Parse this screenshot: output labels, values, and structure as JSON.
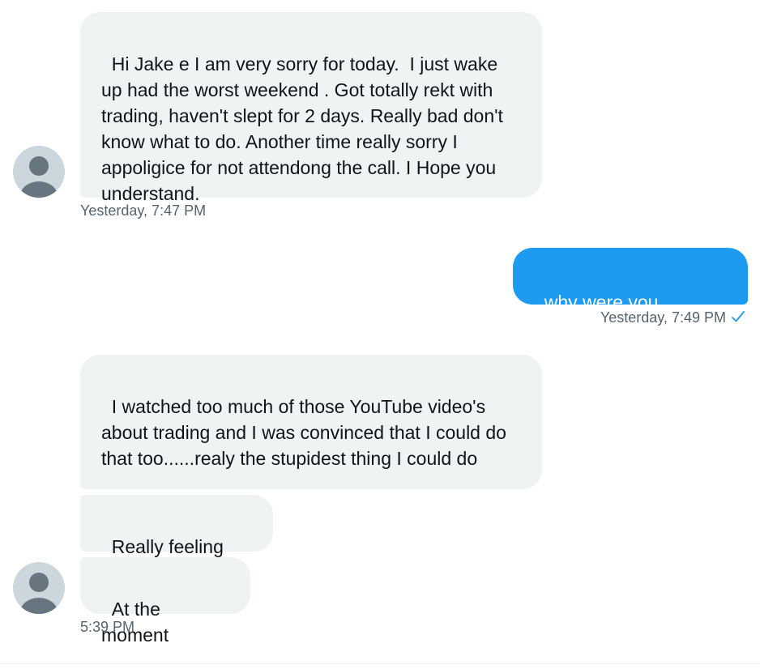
{
  "messages": [
    {
      "sender": "other",
      "text": "Hi Jake e I am very sorry for today.  I just wake up had the worst weekend . Got totally rekt with trading, haven't slept for 2 days. Really bad don't know what to do. Another time really sorry I appoligice for not attendong the call. I Hope you understand.",
      "timestamp": "Yesterday, 7:47 PM"
    },
    {
      "sender": "self",
      "text": "why were you trading?",
      "timestamp": "Yesterday, 7:49 PM",
      "status_icon": "checkmark-sent-icon"
    },
    {
      "sender": "other",
      "text": "I watched too much of those YouTube video's about trading and I was convinced that I could do that too......realy the stupidest thing I could do"
    },
    {
      "sender": "other",
      "text": "Really feeling bad"
    },
    {
      "sender": "other",
      "text": "At the moment",
      "timestamp": "5:39 PM"
    }
  ],
  "colors": {
    "incoming_bubble": "#eff3f4",
    "outgoing_bubble": "#1d9bf0",
    "timestamp_text": "#536471",
    "avatar_bg": "#ccd6dd",
    "avatar_silhouette": "#66757f",
    "check_icon": "#1d9bf0"
  },
  "icons": {
    "avatar": "default-profile-avatar-icon",
    "read_receipt": "checkmark-icon"
  }
}
